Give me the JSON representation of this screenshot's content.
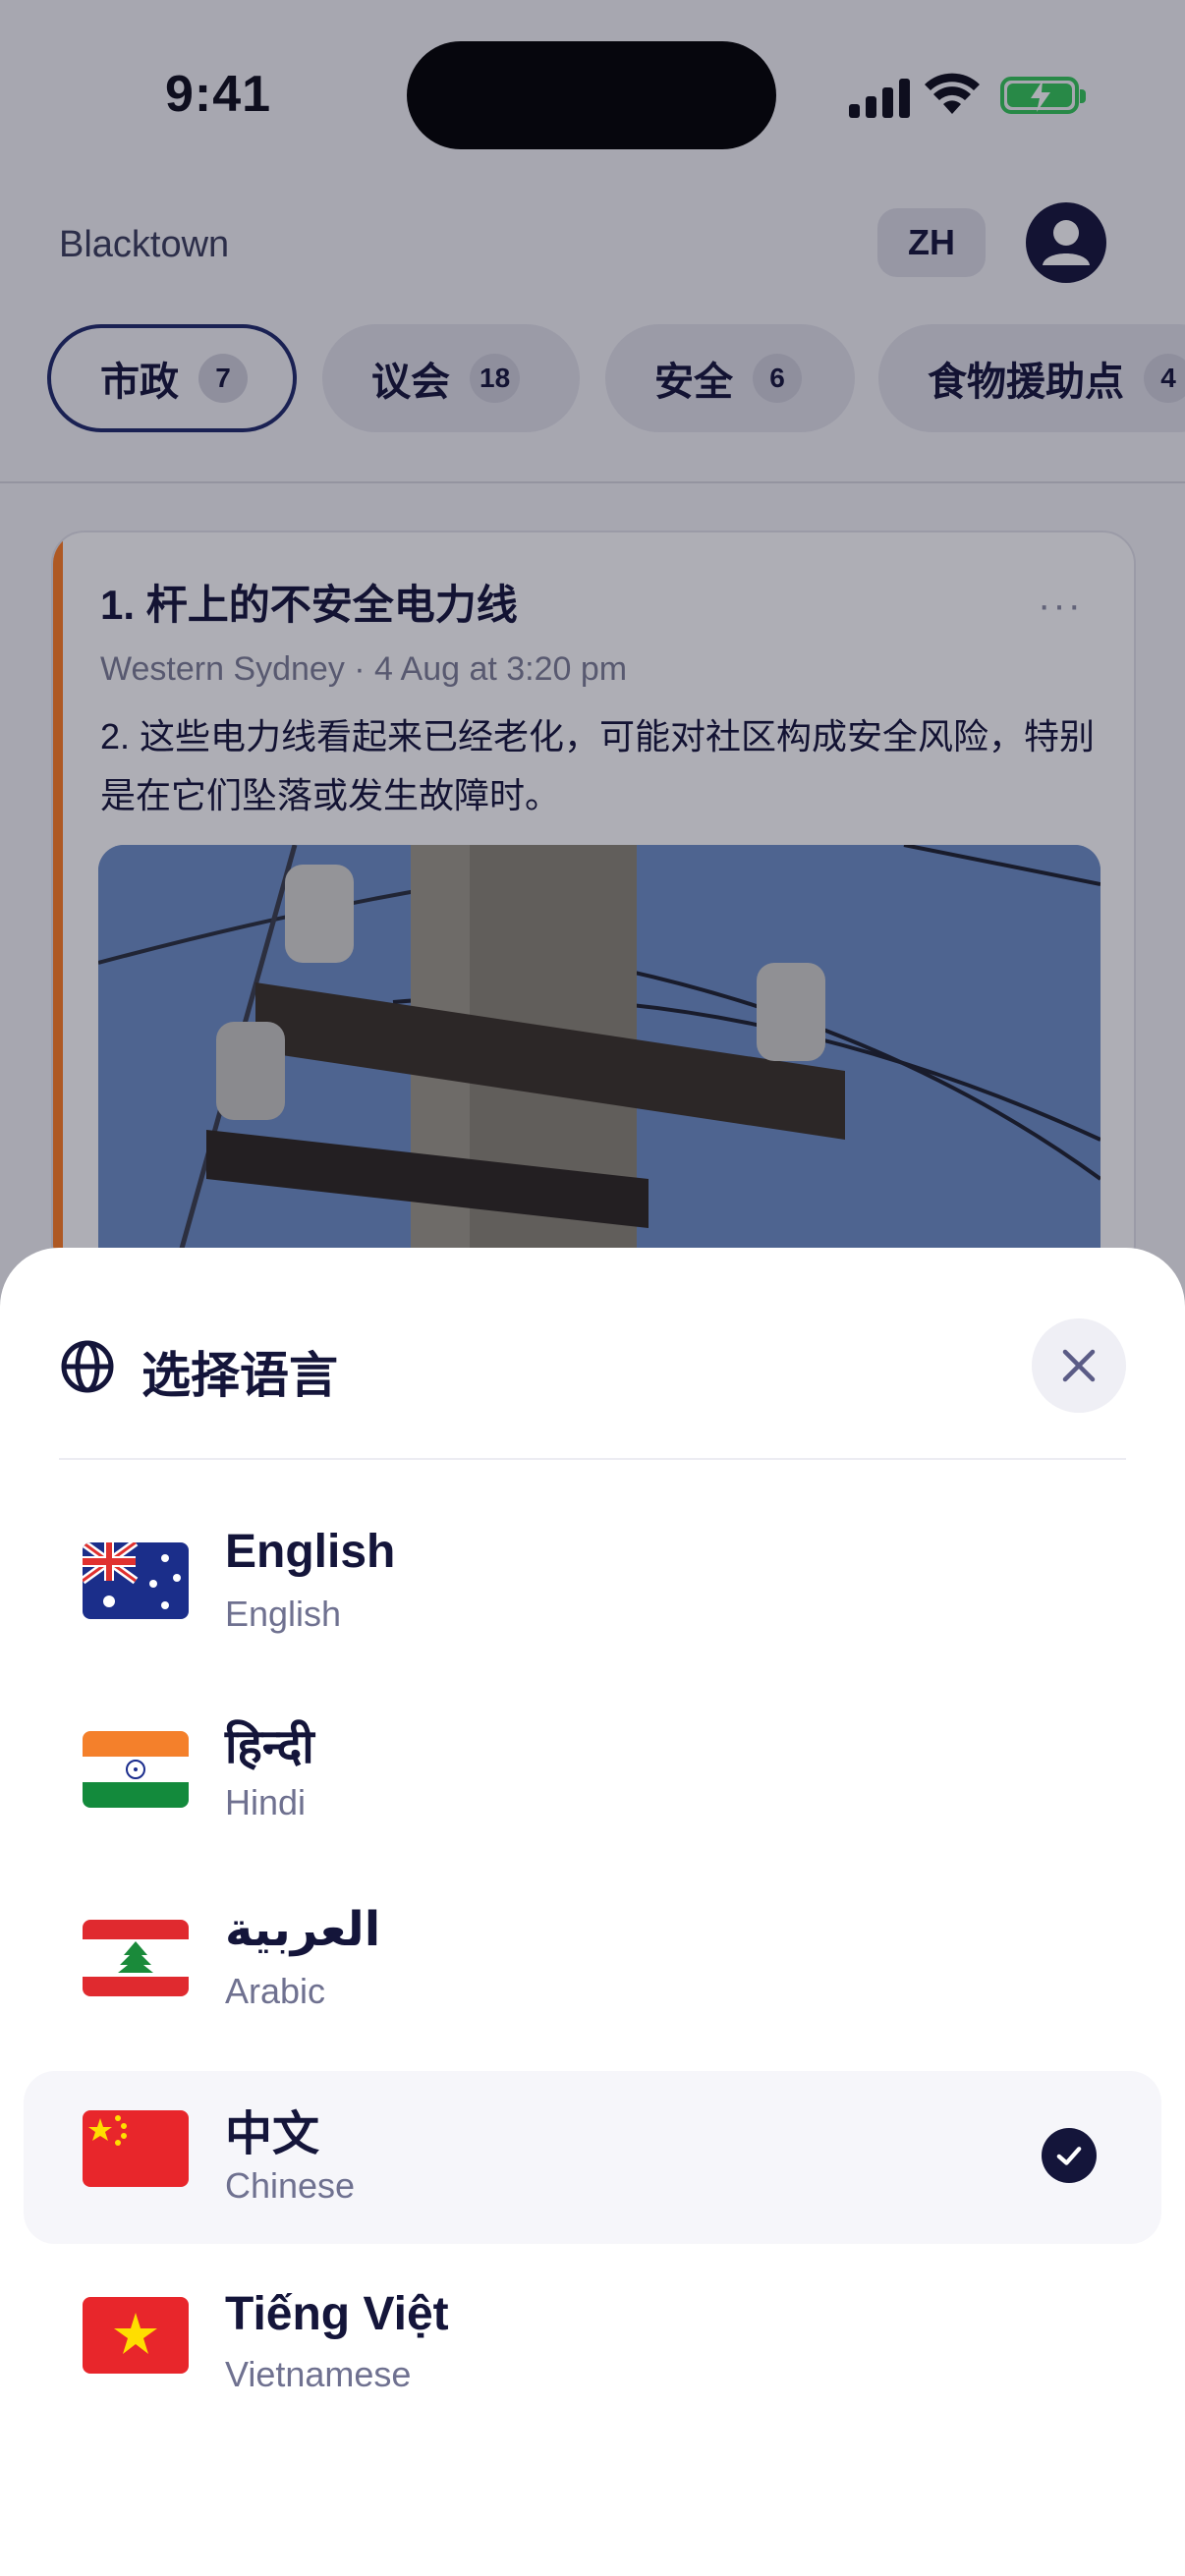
{
  "status_bar": {
    "time": "9:41"
  },
  "header": {
    "location": "Blacktown",
    "language_code": "ZH"
  },
  "tabs": [
    {
      "label": "市政",
      "count": "7",
      "active": true
    },
    {
      "label": "议会",
      "count": "18",
      "active": false
    },
    {
      "label": "安全",
      "count": "6",
      "active": false
    },
    {
      "label": "食物援助点",
      "count": "4",
      "active": false
    }
  ],
  "card": {
    "title": "1. 杆上的不安全电力线",
    "meta": "Western Sydney · 4 Aug at 3:20 pm",
    "body": "2. 这些电力线看起来已经老化，可能对社区构成安全风险，特别是在它们坠落或发生故障时。",
    "more": "···",
    "accent_color": "#ff7f24"
  },
  "sheet": {
    "title": "选择语言",
    "languages": [
      {
        "name": "English",
        "sub": "English",
        "flag": "australia-flag",
        "selected": false
      },
      {
        "name": "हिन्दी",
        "sub": "Hindi",
        "flag": "india-flag",
        "selected": false
      },
      {
        "name": "العربية",
        "sub": "Arabic",
        "flag": "lebanon-flag",
        "selected": false
      },
      {
        "name": "中文",
        "sub": "Chinese",
        "flag": "china-flag",
        "selected": true
      },
      {
        "name": "Tiếng Việt",
        "sub": "Vietnamese",
        "flag": "vietnam-flag",
        "selected": false
      }
    ]
  },
  "colors": {
    "primary": "#14153a",
    "accent_orange": "#ff7f24",
    "battery_green": "#34c759"
  }
}
